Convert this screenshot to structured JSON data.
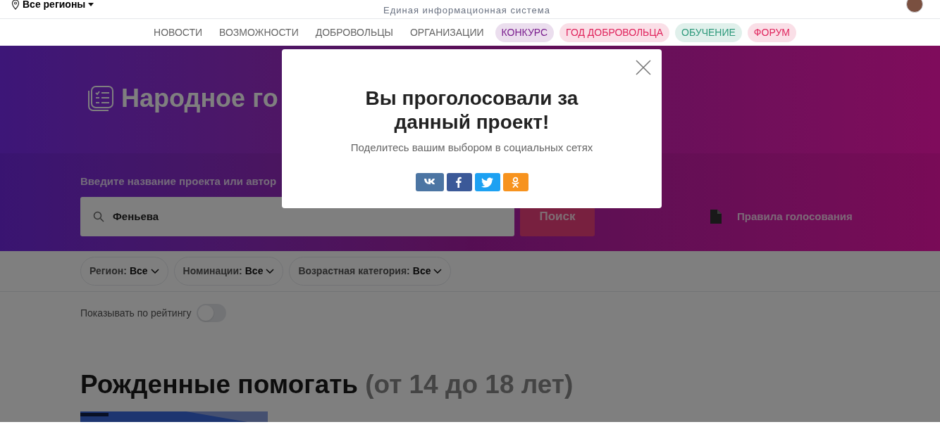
{
  "header": {
    "region": "Все регионы",
    "subtitle": "Единая информационная система"
  },
  "nav": [
    {
      "label": "НОВОСТИ",
      "kind": "plain"
    },
    {
      "label": "ВОЗМОЖНОСТИ",
      "kind": "plain"
    },
    {
      "label": "ДОБРОВОЛЬЦЫ",
      "kind": "plain"
    },
    {
      "label": "ОРГАНИЗАЦИИ",
      "kind": "plain"
    },
    {
      "label": "КОНКУРС",
      "kind": "pill",
      "color": "#7b1f8f"
    },
    {
      "label": "ГОД ДОБРОВОЛЬЦА",
      "kind": "pill",
      "color": "#e0265e"
    },
    {
      "label": "ОБУЧЕНИЕ",
      "kind": "pill",
      "color": "#2f9a7c"
    },
    {
      "label": "ФОРУМ",
      "kind": "pill",
      "color": "#e0265e"
    }
  ],
  "hero": {
    "title": "Народное го",
    "search_label": "Введите название проекта или автор",
    "search_value": "Феньева",
    "search_button": "Поиск",
    "rules_link": "Правила голосования"
  },
  "filters": [
    {
      "label": "Регион:",
      "value": "Все"
    },
    {
      "label": "Номинации:",
      "value": "Все"
    },
    {
      "label": "Возрастная категория:",
      "value": "Все"
    }
  ],
  "rating_toggle": {
    "label": "Показывать по рейтингу",
    "on": false
  },
  "section": {
    "title": "Рожденные помогать",
    "suffix": "(от 14 до 18 лет)"
  },
  "modal": {
    "title": "Вы проголосовали за данный проект!",
    "text": "Поделитесь вашим выбором в социальных сетях",
    "share": [
      {
        "kind": "vk",
        "color": "#4c75a3"
      },
      {
        "kind": "facebook",
        "color": "#3b5998"
      },
      {
        "kind": "twitter",
        "color": "#1da1f2"
      },
      {
        "kind": "ok",
        "color": "#f7931e"
      }
    ]
  }
}
